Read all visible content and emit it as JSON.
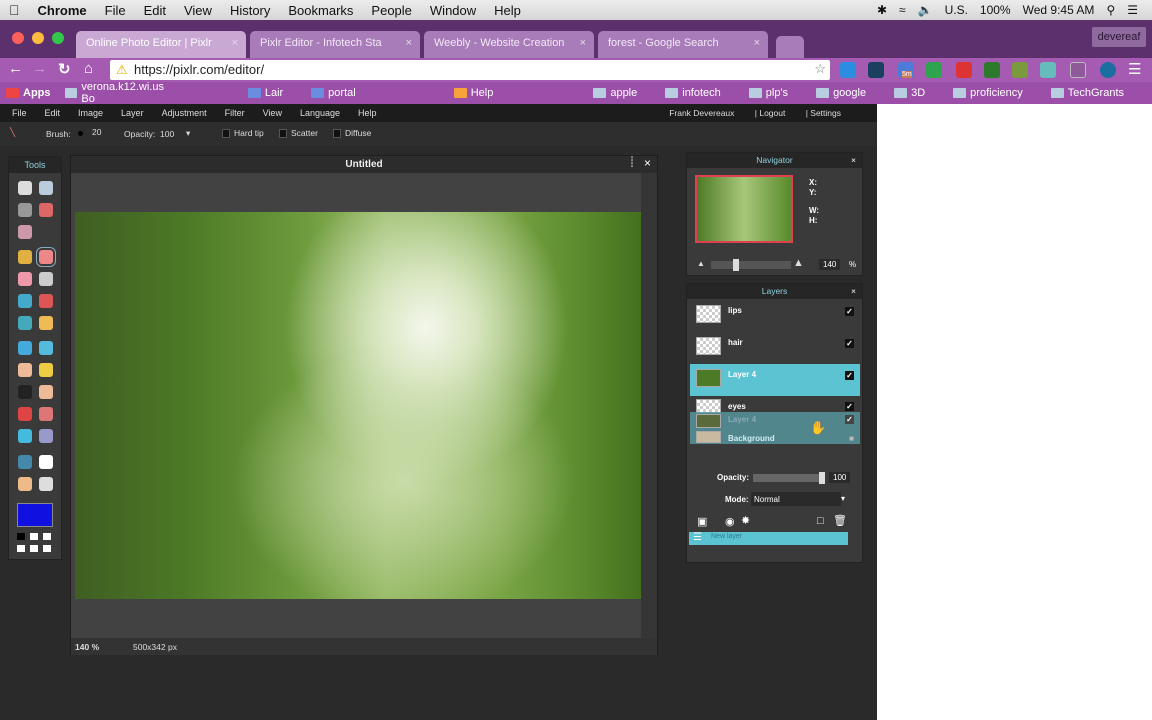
{
  "mac_menu": {
    "apple": "",
    "app": "Chrome",
    "items": [
      "File",
      "Edit",
      "View",
      "History",
      "Bookmarks",
      "People",
      "Window",
      "Help"
    ],
    "status": {
      "input": "U.S.",
      "battery": "100%",
      "clock": "Wed 9:45 AM"
    }
  },
  "chrome": {
    "tabs": [
      {
        "title": "Online Photo Editor | Pixlr",
        "active": true
      },
      {
        "title": "Pixlr Editor - Infotech Sta"
      },
      {
        "title": "Weebly - Website Creation"
      },
      {
        "title": "forest - Google Search"
      }
    ],
    "profile": "devereaf",
    "url": "https://pixlr.com/editor/",
    "bookmarks": [
      "Apps",
      "verona.k12.wi.us Bo",
      "Lair",
      "portal",
      "Help",
      "apple",
      "infotech",
      "plp's",
      "google",
      "3D",
      "proficiency",
      "TechGrants"
    ],
    "extension_badge": "5m"
  },
  "pixlr": {
    "menu": [
      "File",
      "Edit",
      "Image",
      "Layer",
      "Adjustment",
      "Filter",
      "View",
      "Language",
      "Help"
    ],
    "user": "Frank Devereaux",
    "logout": "Logout",
    "settings": "Settings",
    "options": {
      "brush_label": "Brush:",
      "brush_size": "20",
      "opacity_label": "Opacity:",
      "opacity": "100",
      "hard_tip": "Hard tip",
      "scatter": "Scatter",
      "diffuse": "Diffuse"
    },
    "tools_title": "Tools",
    "primary_color": "#1010e0",
    "canvas": {
      "title": "Untitled",
      "zoom": "140",
      "zoom_unit": "%",
      "size": "500x342 px"
    },
    "navigator": {
      "title": "Navigator",
      "x": "X:",
      "y": "Y:",
      "w": "W:",
      "h": "H:",
      "zoom": "140",
      "unit": "%"
    },
    "layers": {
      "title": "Layers",
      "items": [
        {
          "name": "lips",
          "visible": true
        },
        {
          "name": "hair",
          "visible": true
        },
        {
          "name": "Layer 4",
          "visible": true,
          "selected": true
        },
        {
          "name": "eyes",
          "visible": true
        },
        {
          "name": "Layer 4",
          "visible": true,
          "dragging": true
        },
        {
          "name": "Background",
          "locked": true
        }
      ],
      "opacity_label": "Opacity:",
      "opacity": "100",
      "mode_label": "Mode:",
      "mode": "Normal",
      "new_layer": "New layer"
    }
  }
}
